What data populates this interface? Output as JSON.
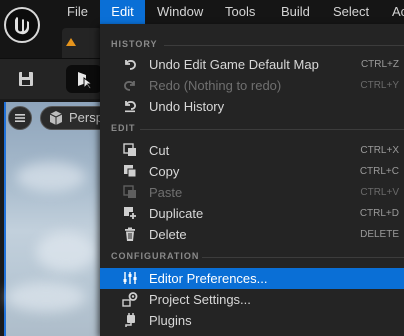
{
  "menubar": {
    "items": [
      "File",
      "Edit",
      "Window",
      "Tools",
      "Build",
      "Select",
      "Ac"
    ],
    "active": "Edit"
  },
  "viewport": {
    "perspective_label": "Persp"
  },
  "dropdown": {
    "sections": [
      {
        "label": "HISTORY"
      },
      {
        "label": "EDIT"
      },
      {
        "label": "CONFIGURATION"
      }
    ],
    "items": [
      {
        "label": "Undo Edit Game Default Map",
        "shortcut": "CTRL+Z",
        "icon": "undo-icon",
        "enabled": true
      },
      {
        "label": "Redo (Nothing to redo)",
        "shortcut": "CTRL+Y",
        "icon": "redo-icon",
        "enabled": false
      },
      {
        "label": "Undo History",
        "shortcut": "",
        "icon": "history-icon",
        "enabled": true
      },
      {
        "label": "Cut",
        "shortcut": "CTRL+X",
        "icon": "cut-icon",
        "enabled": true
      },
      {
        "label": "Copy",
        "shortcut": "CTRL+C",
        "icon": "copy-icon",
        "enabled": true
      },
      {
        "label": "Paste",
        "shortcut": "CTRL+V",
        "icon": "paste-icon",
        "enabled": false
      },
      {
        "label": "Duplicate",
        "shortcut": "CTRL+D",
        "icon": "duplicate-icon",
        "enabled": true
      },
      {
        "label": "Delete",
        "shortcut": "DELETE",
        "icon": "trash-icon",
        "enabled": true
      },
      {
        "label": "Editor Preferences...",
        "shortcut": "",
        "icon": "sliders-icon",
        "enabled": true,
        "highlighted": true
      },
      {
        "label": "Project Settings...",
        "shortcut": "",
        "icon": "settings-icon",
        "enabled": true
      },
      {
        "label": "Plugins",
        "shortcut": "",
        "icon": "plug-icon",
        "enabled": true
      }
    ]
  },
  "colors": {
    "accent": "#0a6fd6",
    "menu_bg": "#242424",
    "bar_bg": "#151515"
  }
}
